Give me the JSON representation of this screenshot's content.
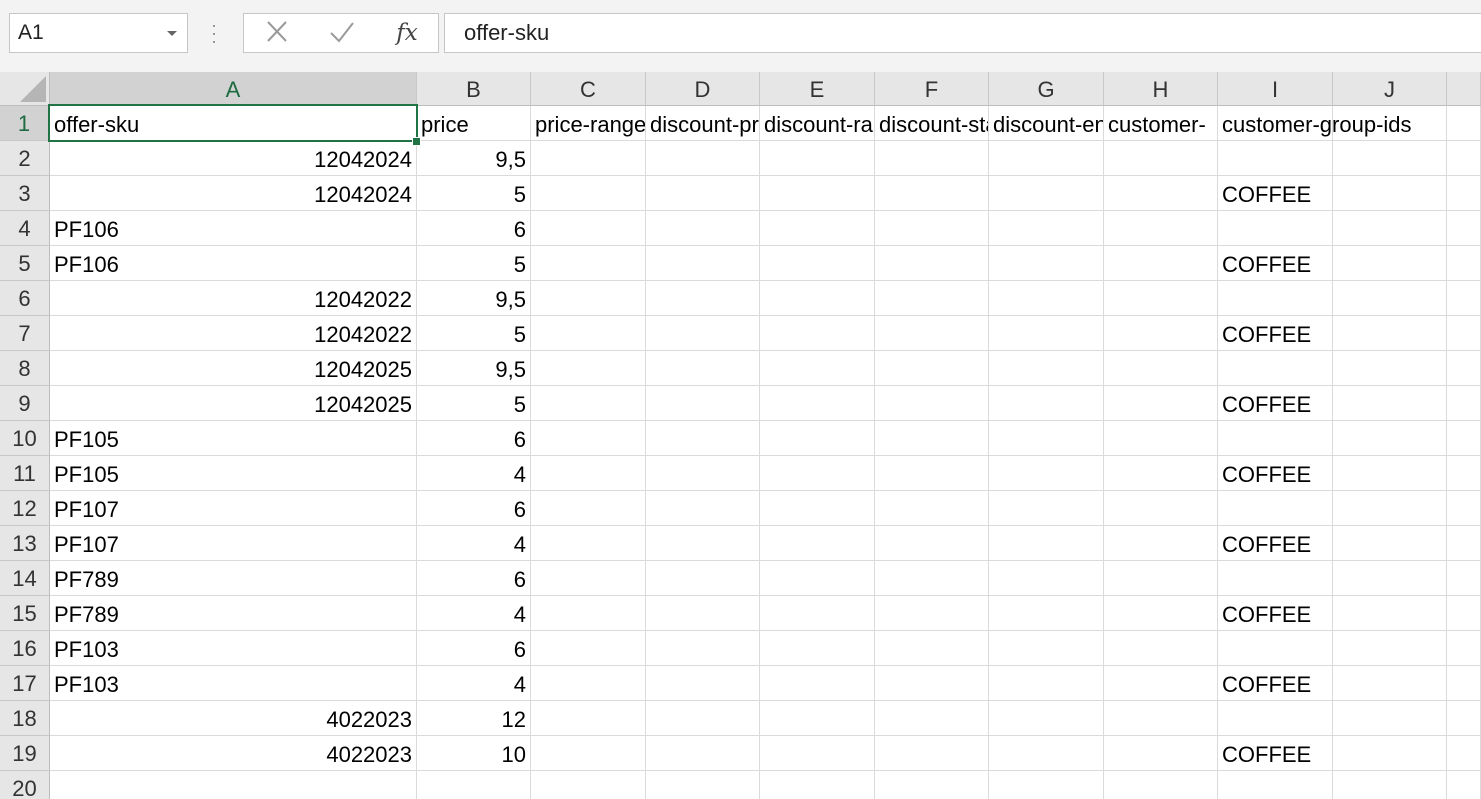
{
  "formula_bar": {
    "name_box": "A1",
    "formula": "offer-sku",
    "fx_label": "fx"
  },
  "icons": {
    "name_box_dropdown": "chevron-down-icon",
    "cancel": "cancel-icon",
    "enter": "enter-icon",
    "function": "fx-icon",
    "more": "more-icon",
    "select_all": "select-all-icon"
  },
  "colors": {
    "accent": "#217346",
    "header_bg": "#e6e6e6",
    "selected_header_bg": "#d2d2d2",
    "gridline": "#dadada"
  },
  "sheet": {
    "active_cell": "A1",
    "columns": [
      "A",
      "B",
      "C",
      "D",
      "E",
      "F",
      "G",
      "H",
      "I",
      "J"
    ],
    "rows": [
      {
        "num": "1",
        "cells": [
          "offer-sku",
          "price",
          "price-range",
          "discount-price",
          "discount-range",
          "discount-start",
          "discount-end",
          "customer-",
          "customer-group-ids",
          ""
        ]
      },
      {
        "num": "2",
        "cells": [
          "12042024",
          "9,5",
          "",
          "",
          "",
          "",
          "",
          "",
          "",
          ""
        ]
      },
      {
        "num": "3",
        "cells": [
          "12042024",
          "5",
          "",
          "",
          "",
          "",
          "",
          "",
          "COFFEE",
          ""
        ]
      },
      {
        "num": "4",
        "cells": [
          "PF106",
          "6",
          "",
          "",
          "",
          "",
          "",
          "",
          "",
          ""
        ]
      },
      {
        "num": "5",
        "cells": [
          "PF106",
          "5",
          "",
          "",
          "",
          "",
          "",
          "",
          "COFFEE",
          ""
        ]
      },
      {
        "num": "6",
        "cells": [
          "12042022",
          "9,5",
          "",
          "",
          "",
          "",
          "",
          "",
          "",
          ""
        ]
      },
      {
        "num": "7",
        "cells": [
          "12042022",
          "5",
          "",
          "",
          "",
          "",
          "",
          "",
          "COFFEE",
          ""
        ]
      },
      {
        "num": "8",
        "cells": [
          "12042025",
          "9,5",
          "",
          "",
          "",
          "",
          "",
          "",
          "",
          ""
        ]
      },
      {
        "num": "9",
        "cells": [
          "12042025",
          "5",
          "",
          "",
          "",
          "",
          "",
          "",
          "COFFEE",
          ""
        ]
      },
      {
        "num": "10",
        "cells": [
          "PF105",
          "6",
          "",
          "",
          "",
          "",
          "",
          "",
          "",
          ""
        ]
      },
      {
        "num": "11",
        "cells": [
          "PF105",
          "4",
          "",
          "",
          "",
          "",
          "",
          "",
          "COFFEE",
          ""
        ]
      },
      {
        "num": "12",
        "cells": [
          "PF107",
          "6",
          "",
          "",
          "",
          "",
          "",
          "",
          "",
          ""
        ]
      },
      {
        "num": "13",
        "cells": [
          "PF107",
          "4",
          "",
          "",
          "",
          "",
          "",
          "",
          "COFFEE",
          ""
        ]
      },
      {
        "num": "14",
        "cells": [
          "PF789",
          "6",
          "",
          "",
          "",
          "",
          "",
          "",
          "",
          ""
        ]
      },
      {
        "num": "15",
        "cells": [
          "PF789",
          "4",
          "",
          "",
          "",
          "",
          "",
          "",
          "COFFEE",
          ""
        ]
      },
      {
        "num": "16",
        "cells": [
          "PF103",
          "6",
          "",
          "",
          "",
          "",
          "",
          "",
          "",
          ""
        ]
      },
      {
        "num": "17",
        "cells": [
          "PF103",
          "4",
          "",
          "",
          "",
          "",
          "",
          "",
          "COFFEE",
          ""
        ]
      },
      {
        "num": "18",
        "cells": [
          "4022023",
          "12",
          "",
          "",
          "",
          "",
          "",
          "",
          "",
          ""
        ]
      },
      {
        "num": "19",
        "cells": [
          "4022023",
          "10",
          "",
          "",
          "",
          "",
          "",
          "",
          "COFFEE",
          ""
        ]
      },
      {
        "num": "20",
        "cells": [
          "",
          "",
          "",
          "",
          "",
          "",
          "",
          "",
          "",
          ""
        ]
      }
    ]
  }
}
